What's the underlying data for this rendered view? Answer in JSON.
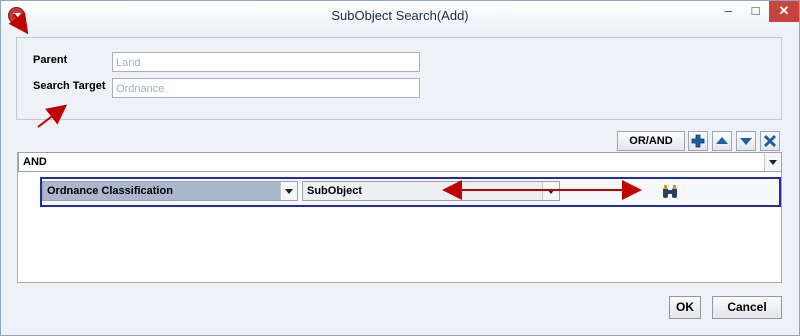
{
  "window": {
    "title": "SubObject Search(Add)",
    "controls": {
      "minimize": "–",
      "maximize": "□",
      "close": "✕"
    }
  },
  "form": {
    "parent_label": "Parent",
    "parent_value": "Land",
    "search_target_label": "Search Target",
    "search_target_value": "Ordnance"
  },
  "toolbar": {
    "or_and_label": "OR/AND",
    "add_icon": "plus-icon",
    "up_icon": "arrow-up-icon",
    "down_icon": "arrow-down-icon",
    "remove_icon": "close-icon"
  },
  "condition_panel": {
    "operator": "AND",
    "row": {
      "attribute": "Ordnance Classification",
      "target": "SubObject"
    }
  },
  "footer": {
    "ok_label": "OK",
    "cancel_label": "Cancel"
  },
  "colors": {
    "accent_blue": "#1f2ea8",
    "annotation_red": "#c00000",
    "selected_combo": "#aab7cc"
  }
}
